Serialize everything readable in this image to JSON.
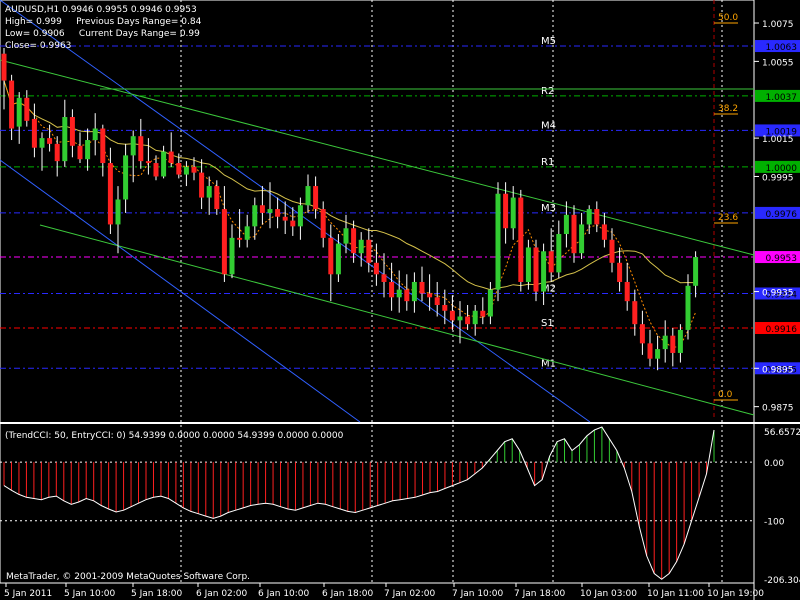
{
  "chart_data": {
    "type": "candlestick",
    "symbol_line": "AUDUSD,H1  0.9946 0.9955 0.9946 0.9953",
    "info_lines": [
      "High= 0.999     Previous Days Range= 0.84",
      "Low= 0.9906     Current Days Range= 0.99",
      "Close= 0.9963"
    ],
    "price_axis": {
      "min": 0.9867,
      "max": 1.0087,
      "ticks": [
        "1.0075",
        "1.0055",
        "1.0015",
        "0.9995",
        "0.9935",
        "0.9895",
        "0.9875"
      ]
    },
    "x_tick_labels": [
      "5 Jan 2011",
      "5 Jan 10:00",
      "5 Jan 18:00",
      "6 Jan 02:00",
      "6 Jan 10:00",
      "6 Jan 18:00",
      "7 Jan 02:00",
      "7 Jan 10:00",
      "7 Jan 18:00",
      "10 Jan 03:00",
      "10 Jan 11:00",
      "10 Jan 19:00"
    ],
    "levels": [
      {
        "label": "M5",
        "value": 1.0063,
        "color": "#2929ff",
        "tag": "1.0063"
      },
      {
        "label": "R2",
        "value": 1.0037,
        "color": "#00b000",
        "tag": "1.0037"
      },
      {
        "label": "M4",
        "value": 1.0019,
        "color": "#2929ff",
        "tag": "1.0019"
      },
      {
        "label": "R1",
        "value": 1.0,
        "color": "#00b000",
        "tag": "1.0000"
      },
      {
        "label": "M3",
        "value": 0.9976,
        "color": "#2929ff",
        "tag": "0.9976"
      },
      {
        "label": "",
        "value": 0.9953,
        "color": "#ff00ff",
        "tag": "0.9953"
      },
      {
        "label": "M2",
        "value": 0.9934,
        "color": "#2929ff",
        "tag": "0.9934"
      },
      {
        "label": "S1",
        "value": 0.9916,
        "color": "#ff0000",
        "tag": "0.9916"
      },
      {
        "label": "M1",
        "value": 0.9895,
        "color": "#2929ff",
        "tag": "0.9895"
      }
    ],
    "fibo_labels": [
      "50.0",
      "38.2",
      "23.6",
      "0.0"
    ],
    "candles": [
      [
        1.0059,
        1.0062,
        1.003,
        1.0045
      ],
      [
        1.0045,
        1.0048,
        1.0014,
        1.002
      ],
      [
        1.0021,
        1.0039,
        1.0012,
        1.0036
      ],
      [
        1.0036,
        1.004,
        1.0021,
        1.0024
      ],
      [
        1.0025,
        1.0033,
        1.0005,
        1.001
      ],
      [
        1.001,
        1.0018,
        0.9998,
        1.0015
      ],
      [
        1.0015,
        1.0022,
        1.0008,
        1.0012
      ],
      [
        1.0012,
        1.0016,
        0.9995,
        1.0003
      ],
      [
        1.0003,
        1.0035,
        1.0,
        1.0026
      ],
      [
        1.0026,
        1.003,
        1.0005,
        1.0011
      ],
      [
        1.0011,
        1.0018,
        1.0002,
        1.0004
      ],
      [
        1.0004,
        1.002,
        0.9998,
        1.0014
      ],
      [
        1.0014,
        1.0028,
        1.0006,
        1.002
      ],
      [
        1.002,
        1.0022,
        0.9995,
        1.0002
      ],
      [
        1.0002,
        1.001,
        0.9965,
        0.997
      ],
      [
        0.997,
        0.999,
        0.9955,
        0.9983
      ],
      [
        0.9983,
        1.0012,
        0.9976,
        1.0006
      ],
      [
        1.0006,
        1.0019,
        0.9992,
        1.0016
      ],
      [
        1.0016,
        1.0025,
        0.9999,
        1.0003
      ],
      [
        1.0003,
        1.0015,
        0.9996,
        1.0002
      ],
      [
        1.0002,
        1.0006,
        0.9993,
        0.9995
      ],
      [
        0.9995,
        1.0011,
        0.9994,
        1.0008
      ],
      [
        1.0008,
        1.0018,
        1.0,
        1.0002
      ],
      [
        1.0002,
        1.0007,
        0.9994,
        0.9996
      ],
      [
        0.9996,
        1.0003,
        0.999,
        1.0
      ],
      [
        1.0,
        1.0005,
        0.9993,
        0.9997
      ],
      [
        0.9997,
        1.0004,
        0.9978,
        0.9984
      ],
      [
        0.9984,
        0.9995,
        0.9975,
        0.999
      ],
      [
        0.999,
        0.9993,
        0.9975,
        0.9978
      ],
      [
        0.9978,
        0.999,
        0.994,
        0.9944
      ],
      [
        0.9944,
        0.997,
        0.9942,
        0.9963
      ],
      [
        0.9963,
        0.9978,
        0.9958,
        0.9962
      ],
      [
        0.9962,
        0.9975,
        0.9958,
        0.9969
      ],
      [
        0.9969,
        0.9984,
        0.9962,
        0.998
      ],
      [
        0.998,
        0.999,
        0.997,
        0.9976
      ],
      [
        0.9976,
        0.9992,
        0.9968,
        0.9978
      ],
      [
        0.9978,
        0.9984,
        0.9968,
        0.9974
      ],
      [
        0.9974,
        0.9982,
        0.9965,
        0.9972
      ],
      [
        0.9972,
        0.9979,
        0.9964,
        0.9969
      ],
      [
        0.9969,
        0.9984,
        0.9962,
        0.998
      ],
      [
        0.998,
        0.9996,
        0.9976,
        0.999
      ],
      [
        0.999,
        0.9995,
        0.9973,
        0.9978
      ],
      [
        0.9978,
        0.9982,
        0.9958,
        0.9963
      ],
      [
        0.9963,
        0.997,
        0.993,
        0.9944
      ],
      [
        0.9944,
        0.9965,
        0.994,
        0.996
      ],
      [
        0.996,
        0.9975,
        0.9955,
        0.9968
      ],
      [
        0.9968,
        0.9972,
        0.995,
        0.9955
      ],
      [
        0.9955,
        0.9966,
        0.9948,
        0.9962
      ],
      [
        0.9962,
        0.9968,
        0.9945,
        0.995
      ],
      [
        0.995,
        0.996,
        0.9938,
        0.9944
      ],
      [
        0.9944,
        0.9955,
        0.9932,
        0.994
      ],
      [
        0.994,
        0.995,
        0.9925,
        0.9932
      ],
      [
        0.9932,
        0.9946,
        0.9924,
        0.9936
      ],
      [
        0.9936,
        0.9944,
        0.9925,
        0.993
      ],
      [
        0.993,
        0.9945,
        0.9924,
        0.994
      ],
      [
        0.994,
        0.9948,
        0.993,
        0.9934
      ],
      [
        0.9934,
        0.9944,
        0.9925,
        0.9932
      ],
      [
        0.9932,
        0.994,
        0.9922,
        0.9928
      ],
      [
        0.9928,
        0.9936,
        0.9918,
        0.9925
      ],
      [
        0.9925,
        0.9933,
        0.9915,
        0.992
      ],
      [
        0.992,
        0.993,
        0.9908,
        0.9922
      ],
      [
        0.9922,
        0.9928,
        0.9915,
        0.9918
      ],
      [
        0.9918,
        0.9928,
        0.9912,
        0.9925
      ],
      [
        0.9925,
        0.9932,
        0.9918,
        0.9922
      ],
      [
        0.9922,
        0.994,
        0.9918,
        0.9936
      ],
      [
        0.9936,
        0.9992,
        0.993,
        0.9986
      ],
      [
        0.9986,
        0.9992,
        0.996,
        0.9968
      ],
      [
        0.9968,
        0.999,
        0.9962,
        0.9984
      ],
      [
        0.9984,
        0.9988,
        0.9935,
        0.994
      ],
      [
        0.994,
        0.9962,
        0.9936,
        0.9958
      ],
      [
        0.9958,
        0.9962,
        0.993,
        0.9935
      ],
      [
        0.9935,
        0.996,
        0.9928,
        0.9956
      ],
      [
        0.9956,
        0.9968,
        0.994,
        0.9945
      ],
      [
        0.9945,
        0.9972,
        0.9942,
        0.9965
      ],
      [
        0.9965,
        0.9982,
        0.9958,
        0.9975
      ],
      [
        0.9975,
        0.998,
        0.995,
        0.9955
      ],
      [
        0.9955,
        0.9976,
        0.9952,
        0.997
      ],
      [
        0.997,
        0.998,
        0.9965,
        0.9978
      ],
      [
        0.9978,
        0.9982,
        0.9966,
        0.997
      ],
      [
        0.997,
        0.9976,
        0.9958,
        0.9962
      ],
      [
        0.9962,
        0.9968,
        0.9945,
        0.995
      ],
      [
        0.995,
        0.9958,
        0.9935,
        0.994
      ],
      [
        0.994,
        0.995,
        0.9925,
        0.993
      ],
      [
        0.993,
        0.9936,
        0.9912,
        0.9918
      ],
      [
        0.9918,
        0.9925,
        0.9902,
        0.9908
      ],
      [
        0.9908,
        0.9915,
        0.9896,
        0.99
      ],
      [
        0.99,
        0.9912,
        0.9894,
        0.9905
      ],
      [
        0.9905,
        0.992,
        0.9898,
        0.9912
      ],
      [
        0.9912,
        0.9916,
        0.9896,
        0.9903
      ],
      [
        0.9903,
        0.9918,
        0.9898,
        0.9915
      ],
      [
        0.9915,
        0.9944,
        0.991,
        0.9938
      ],
      [
        0.9938,
        0.9956,
        0.9932,
        0.9953
      ]
    ],
    "cci": {
      "header": "(TrendCCI: 50, EntryCCI: 0)  54.9399 0.0000 0.0000 54.9399 0.0000 0.0000",
      "axis_labels": [
        "56.6572",
        "0.00",
        "-100",
        "-206.304"
      ],
      "min": -206.304,
      "max": 56.6572,
      "values": [
        -40,
        -48,
        -55,
        -60,
        -62,
        -64,
        -60,
        -58,
        -66,
        -72,
        -68,
        -62,
        -66,
        -74,
        -80,
        -85,
        -82,
        -76,
        -70,
        -64,
        -60,
        -58,
        -62,
        -70,
        -78,
        -84,
        -88,
        -92,
        -96,
        -92,
        -86,
        -82,
        -78,
        -74,
        -72,
        -70,
        -72,
        -76,
        -80,
        -82,
        -78,
        -74,
        -70,
        -72,
        -76,
        -80,
        -84,
        -86,
        -82,
        -78,
        -74,
        -70,
        -66,
        -64,
        -62,
        -60,
        -56,
        -52,
        -50,
        -45,
        -40,
        -35,
        -30,
        -20,
        -10,
        5,
        20,
        35,
        40,
        20,
        -10,
        -40,
        -30,
        10,
        35,
        40,
        20,
        30,
        45,
        55,
        60,
        40,
        20,
        -10,
        -50,
        -110,
        -160,
        -190,
        -200,
        -190,
        -170,
        -140,
        -100,
        -60,
        -20,
        55
      ]
    },
    "copyright": "MetaTrader, © 2001-2009 MetaQuotes Software Corp."
  }
}
